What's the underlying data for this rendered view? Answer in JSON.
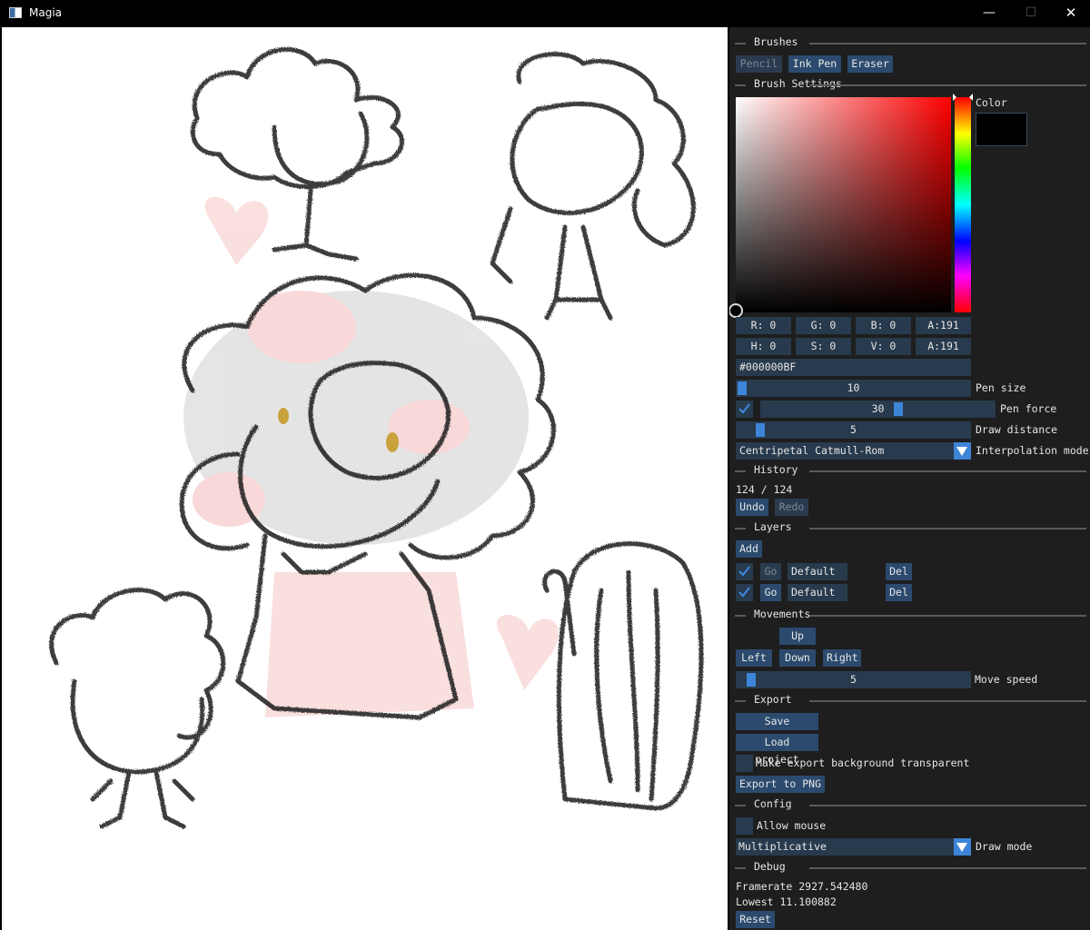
{
  "window": {
    "title": "Magia",
    "minimize": "—",
    "maximize": "☐",
    "close": "✕"
  },
  "brushes": {
    "header": "Brushes",
    "items": [
      "Pencil",
      "Ink Pen",
      "Eraser"
    ]
  },
  "brush_settings": {
    "header": "Brush Settings",
    "color_label": "Color",
    "current_color": "#000000",
    "rgba": {
      "r": "R:  0",
      "g": "G:  0",
      "b": "B:  0",
      "a": "A:191"
    },
    "hsva": {
      "h": "H:  0",
      "s": "S:  0",
      "v": "V:  0",
      "a": "A:191"
    },
    "hex": "#000000BF",
    "pen_size": {
      "value": "10",
      "label": "Pen size",
      "fraction": 0.0
    },
    "pen_force": {
      "value": "30",
      "label": "Pen force",
      "fraction": 0.6,
      "enabled": true
    },
    "draw_distance": {
      "value": "5",
      "label": "Draw distance",
      "fraction": 0.05
    },
    "interpolation": {
      "value": "Centripetal Catmull-Rom",
      "label": "Interpolation mode"
    }
  },
  "history": {
    "header": "History",
    "counter": "124 / 124",
    "undo": "Undo",
    "redo": "Redo"
  },
  "layers": {
    "header": "Layers",
    "add": "Add",
    "rows": [
      {
        "visible": true,
        "go": "Go",
        "name": "Default",
        "del": "Del",
        "active": true
      },
      {
        "visible": true,
        "go": "Go",
        "name": "Default",
        "del": "Del",
        "active": false
      }
    ]
  },
  "movements": {
    "header": "Movements",
    "up": "Up",
    "left": "Left",
    "down": "Down",
    "right": "Right",
    "move_speed": {
      "value": "5",
      "label": "Move speed",
      "fraction": 0.05
    }
  },
  "export": {
    "header": "Export",
    "save": "Save project",
    "load": "Load project",
    "transparent_label": "Make export background transparent",
    "transparent": false,
    "export_png": "Export to PNG"
  },
  "config": {
    "header": "Config",
    "allow_mouse_label": "Allow mouse",
    "allow_mouse": false,
    "draw_mode": {
      "value": "Multiplicative",
      "label": "Draw mode"
    }
  },
  "debug": {
    "header": "Debug",
    "framerate": "Framerate 2927.542480",
    "lowest": "Lowest 11.100882",
    "reset": "Reset"
  },
  "icons": {
    "app": "magia-app-icon",
    "check": "checkmark-icon",
    "combo": "triangle-down-icon"
  }
}
